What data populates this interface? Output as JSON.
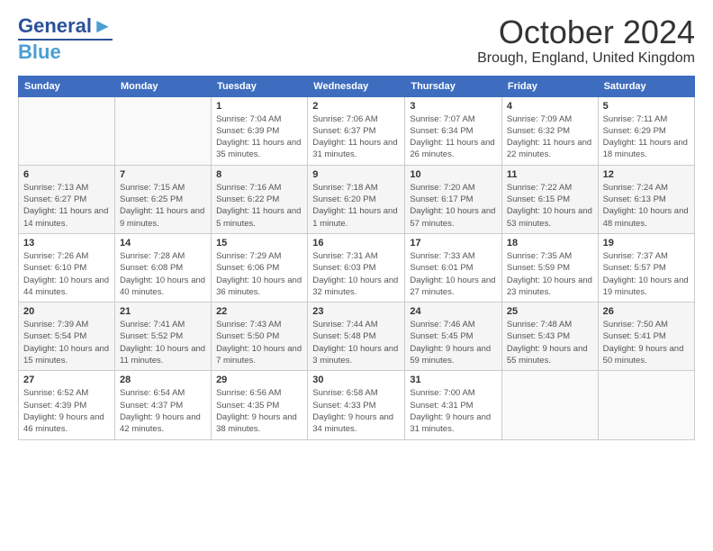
{
  "header": {
    "logo_general": "General",
    "logo_blue": "Blue",
    "month": "October 2024",
    "location": "Brough, England, United Kingdom"
  },
  "weekdays": [
    "Sunday",
    "Monday",
    "Tuesday",
    "Wednesday",
    "Thursday",
    "Friday",
    "Saturday"
  ],
  "weeks": [
    [
      {
        "day": "",
        "sunrise": "",
        "sunset": "",
        "daylight": ""
      },
      {
        "day": "",
        "sunrise": "",
        "sunset": "",
        "daylight": ""
      },
      {
        "day": "1",
        "sunrise": "Sunrise: 7:04 AM",
        "sunset": "Sunset: 6:39 PM",
        "daylight": "Daylight: 11 hours and 35 minutes."
      },
      {
        "day": "2",
        "sunrise": "Sunrise: 7:06 AM",
        "sunset": "Sunset: 6:37 PM",
        "daylight": "Daylight: 11 hours and 31 minutes."
      },
      {
        "day": "3",
        "sunrise": "Sunrise: 7:07 AM",
        "sunset": "Sunset: 6:34 PM",
        "daylight": "Daylight: 11 hours and 26 minutes."
      },
      {
        "day": "4",
        "sunrise": "Sunrise: 7:09 AM",
        "sunset": "Sunset: 6:32 PM",
        "daylight": "Daylight: 11 hours and 22 minutes."
      },
      {
        "day": "5",
        "sunrise": "Sunrise: 7:11 AM",
        "sunset": "Sunset: 6:29 PM",
        "daylight": "Daylight: 11 hours and 18 minutes."
      }
    ],
    [
      {
        "day": "6",
        "sunrise": "Sunrise: 7:13 AM",
        "sunset": "Sunset: 6:27 PM",
        "daylight": "Daylight: 11 hours and 14 minutes."
      },
      {
        "day": "7",
        "sunrise": "Sunrise: 7:15 AM",
        "sunset": "Sunset: 6:25 PM",
        "daylight": "Daylight: 11 hours and 9 minutes."
      },
      {
        "day": "8",
        "sunrise": "Sunrise: 7:16 AM",
        "sunset": "Sunset: 6:22 PM",
        "daylight": "Daylight: 11 hours and 5 minutes."
      },
      {
        "day": "9",
        "sunrise": "Sunrise: 7:18 AM",
        "sunset": "Sunset: 6:20 PM",
        "daylight": "Daylight: 11 hours and 1 minute."
      },
      {
        "day": "10",
        "sunrise": "Sunrise: 7:20 AM",
        "sunset": "Sunset: 6:17 PM",
        "daylight": "Daylight: 10 hours and 57 minutes."
      },
      {
        "day": "11",
        "sunrise": "Sunrise: 7:22 AM",
        "sunset": "Sunset: 6:15 PM",
        "daylight": "Daylight: 10 hours and 53 minutes."
      },
      {
        "day": "12",
        "sunrise": "Sunrise: 7:24 AM",
        "sunset": "Sunset: 6:13 PM",
        "daylight": "Daylight: 10 hours and 48 minutes."
      }
    ],
    [
      {
        "day": "13",
        "sunrise": "Sunrise: 7:26 AM",
        "sunset": "Sunset: 6:10 PM",
        "daylight": "Daylight: 10 hours and 44 minutes."
      },
      {
        "day": "14",
        "sunrise": "Sunrise: 7:28 AM",
        "sunset": "Sunset: 6:08 PM",
        "daylight": "Daylight: 10 hours and 40 minutes."
      },
      {
        "day": "15",
        "sunrise": "Sunrise: 7:29 AM",
        "sunset": "Sunset: 6:06 PM",
        "daylight": "Daylight: 10 hours and 36 minutes."
      },
      {
        "day": "16",
        "sunrise": "Sunrise: 7:31 AM",
        "sunset": "Sunset: 6:03 PM",
        "daylight": "Daylight: 10 hours and 32 minutes."
      },
      {
        "day": "17",
        "sunrise": "Sunrise: 7:33 AM",
        "sunset": "Sunset: 6:01 PM",
        "daylight": "Daylight: 10 hours and 27 minutes."
      },
      {
        "day": "18",
        "sunrise": "Sunrise: 7:35 AM",
        "sunset": "Sunset: 5:59 PM",
        "daylight": "Daylight: 10 hours and 23 minutes."
      },
      {
        "day": "19",
        "sunrise": "Sunrise: 7:37 AM",
        "sunset": "Sunset: 5:57 PM",
        "daylight": "Daylight: 10 hours and 19 minutes."
      }
    ],
    [
      {
        "day": "20",
        "sunrise": "Sunrise: 7:39 AM",
        "sunset": "Sunset: 5:54 PM",
        "daylight": "Daylight: 10 hours and 15 minutes."
      },
      {
        "day": "21",
        "sunrise": "Sunrise: 7:41 AM",
        "sunset": "Sunset: 5:52 PM",
        "daylight": "Daylight: 10 hours and 11 minutes."
      },
      {
        "day": "22",
        "sunrise": "Sunrise: 7:43 AM",
        "sunset": "Sunset: 5:50 PM",
        "daylight": "Daylight: 10 hours and 7 minutes."
      },
      {
        "day": "23",
        "sunrise": "Sunrise: 7:44 AM",
        "sunset": "Sunset: 5:48 PM",
        "daylight": "Daylight: 10 hours and 3 minutes."
      },
      {
        "day": "24",
        "sunrise": "Sunrise: 7:46 AM",
        "sunset": "Sunset: 5:45 PM",
        "daylight": "Daylight: 9 hours and 59 minutes."
      },
      {
        "day": "25",
        "sunrise": "Sunrise: 7:48 AM",
        "sunset": "Sunset: 5:43 PM",
        "daylight": "Daylight: 9 hours and 55 minutes."
      },
      {
        "day": "26",
        "sunrise": "Sunrise: 7:50 AM",
        "sunset": "Sunset: 5:41 PM",
        "daylight": "Daylight: 9 hours and 50 minutes."
      }
    ],
    [
      {
        "day": "27",
        "sunrise": "Sunrise: 6:52 AM",
        "sunset": "Sunset: 4:39 PM",
        "daylight": "Daylight: 9 hours and 46 minutes."
      },
      {
        "day": "28",
        "sunrise": "Sunrise: 6:54 AM",
        "sunset": "Sunset: 4:37 PM",
        "daylight": "Daylight: 9 hours and 42 minutes."
      },
      {
        "day": "29",
        "sunrise": "Sunrise: 6:56 AM",
        "sunset": "Sunset: 4:35 PM",
        "daylight": "Daylight: 9 hours and 38 minutes."
      },
      {
        "day": "30",
        "sunrise": "Sunrise: 6:58 AM",
        "sunset": "Sunset: 4:33 PM",
        "daylight": "Daylight: 9 hours and 34 minutes."
      },
      {
        "day": "31",
        "sunrise": "Sunrise: 7:00 AM",
        "sunset": "Sunset: 4:31 PM",
        "daylight": "Daylight: 9 hours and 31 minutes."
      },
      {
        "day": "",
        "sunrise": "",
        "sunset": "",
        "daylight": ""
      },
      {
        "day": "",
        "sunrise": "",
        "sunset": "",
        "daylight": ""
      }
    ]
  ]
}
